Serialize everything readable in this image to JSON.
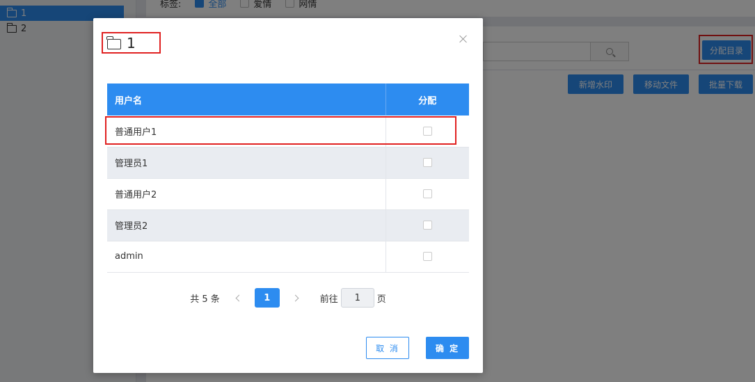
{
  "background": {
    "tree": [
      {
        "label": "1",
        "active": true
      },
      {
        "label": "2",
        "active": false
      }
    ],
    "filter": {
      "label": "标签:",
      "options": [
        {
          "label": "全部",
          "checked": true
        },
        {
          "label": "爱情",
          "checked": false
        },
        {
          "label": "网情",
          "checked": false
        }
      ]
    },
    "assign_button": "分配目录",
    "toolbar": [
      "新增水印",
      "移动文件",
      "批量下载"
    ]
  },
  "dialog": {
    "title": "1",
    "close_icon": "close-icon",
    "table": {
      "headers": [
        "用户名",
        "分配"
      ],
      "rows": [
        {
          "username": "普通用户1",
          "assigned": false
        },
        {
          "username": "管理员1",
          "assigned": false
        },
        {
          "username": "普通用户2",
          "assigned": false
        },
        {
          "username": "管理员2",
          "assigned": false
        },
        {
          "username": "admin",
          "assigned": false
        }
      ]
    },
    "pagination": {
      "total": "共 5 条",
      "current_page": "1",
      "goto_prefix": "前往",
      "goto_value": "1",
      "goto_suffix": "页"
    },
    "cancel_label": "取 消",
    "ok_label": "确 定"
  },
  "colors": {
    "primary": "#2d8cf0",
    "highlight": "#e02020"
  }
}
